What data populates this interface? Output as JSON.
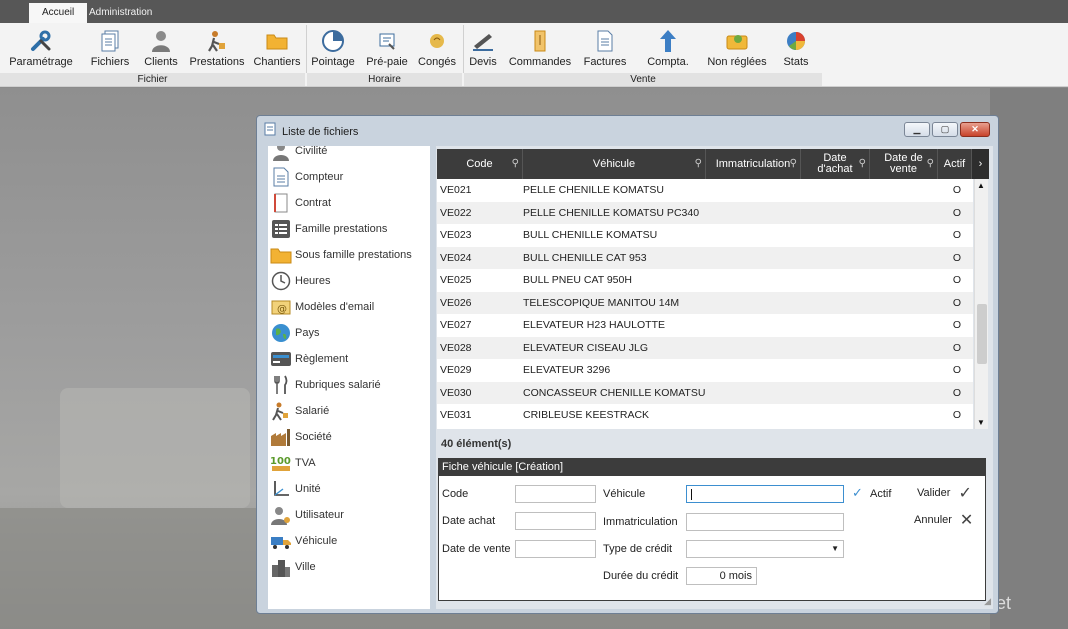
{
  "tabs": [
    {
      "label": "Accueil"
    },
    {
      "label": "Administration"
    }
  ],
  "ribbon": {
    "groups": [
      {
        "title": "Fichier",
        "items": [
          {
            "label": "Paramétrage",
            "icon": "wrench-icon"
          },
          {
            "label": "Fichiers",
            "icon": "files-icon"
          },
          {
            "label": "Clients",
            "icon": "user-icon"
          },
          {
            "label": "Prestations",
            "icon": "worker-icon"
          },
          {
            "label": "Chantiers",
            "icon": "folder-icon"
          }
        ]
      },
      {
        "title": "Horaire",
        "items": [
          {
            "label": "Pointage",
            "icon": "clock-icon"
          },
          {
            "label": "Pré-paie",
            "icon": "payroll-icon"
          },
          {
            "label": "Congés",
            "icon": "vacation-icon"
          }
        ]
      },
      {
        "title": "Vente",
        "items": [
          {
            "label": "Devis",
            "icon": "quote-icon"
          },
          {
            "label": "Commandes",
            "icon": "order-icon"
          },
          {
            "label": "Factures",
            "icon": "invoice-icon"
          },
          {
            "label": "Compta.",
            "icon": "upload-arrow-icon"
          },
          {
            "label": "Non réglées",
            "icon": "wallet-icon"
          },
          {
            "label": "Stats",
            "icon": "pie-chart-icon"
          }
        ]
      }
    ]
  },
  "window": {
    "title": "Liste de fichiers"
  },
  "sidebar": {
    "items": [
      {
        "label": "Civilité",
        "icon": "person-icon"
      },
      {
        "label": "Compteur",
        "icon": "document-icon"
      },
      {
        "label": "Contrat",
        "icon": "contract-icon"
      },
      {
        "label": "Famille prestations",
        "icon": "list-icon"
      },
      {
        "label": "Sous famille prestations",
        "icon": "folder-icon"
      },
      {
        "label": "Heures",
        "icon": "clock-icon"
      },
      {
        "label": "Modèles d'email",
        "icon": "email-icon"
      },
      {
        "label": "Pays",
        "icon": "globe-icon"
      },
      {
        "label": "Règlement",
        "icon": "payment-icon"
      },
      {
        "label": "Rubriques salarié",
        "icon": "cutlery-icon"
      },
      {
        "label": "Salarié",
        "icon": "worker-icon"
      },
      {
        "label": "Société",
        "icon": "factory-icon"
      },
      {
        "label": "TVA",
        "icon": "percent-icon"
      },
      {
        "label": "Unité",
        "icon": "axis-icon"
      },
      {
        "label": "Utilisateur",
        "icon": "user-gear-icon"
      },
      {
        "label": "Véhicule",
        "icon": "truck-icon"
      },
      {
        "label": "Ville",
        "icon": "city-icon"
      }
    ]
  },
  "grid": {
    "headers": {
      "code": "Code",
      "vehicule": "Véhicule",
      "immat": "Immatriculation",
      "date_achat": "Date\nd'achat",
      "date_vente": "Date de\nvente",
      "actif": "Actif"
    },
    "rows": [
      {
        "code": "VE021",
        "vehicule": "PELLE CHENILLE KOMATSU",
        "actif": "O"
      },
      {
        "code": "VE022",
        "vehicule": "PELLE CHENILLE KOMATSU PC340",
        "actif": "O"
      },
      {
        "code": "VE023",
        "vehicule": "BULL CHENILLE KOMATSU",
        "actif": "O"
      },
      {
        "code": "VE024",
        "vehicule": "BULL CHENILLE CAT 953",
        "actif": "O"
      },
      {
        "code": "VE025",
        "vehicule": "BULL PNEU CAT 950H",
        "actif": "O"
      },
      {
        "code": "VE026",
        "vehicule": "TELESCOPIQUE MANITOU 14M",
        "actif": "O"
      },
      {
        "code": "VE027",
        "vehicule": "ELEVATEUR H23 HAULOTTE",
        "actif": "O"
      },
      {
        "code": "VE028",
        "vehicule": "ELEVATEUR CISEAU JLG",
        "actif": "O"
      },
      {
        "code": "VE029",
        "vehicule": "ELEVATEUR 3296",
        "actif": "O"
      },
      {
        "code": "VE030",
        "vehicule": "CONCASSEUR CHENILLE KOMATSU",
        "actif": "O"
      },
      {
        "code": "VE031",
        "vehicule": "CRIBLEUSE KEESTRACK",
        "actif": "O"
      }
    ],
    "count": "40 élément(s)"
  },
  "form": {
    "title": "Fiche véhicule [Création]",
    "code_label": "Code",
    "date_achat_label": "Date achat",
    "date_vente_label": "Date de vente",
    "vehicule_label": "Véhicule",
    "immat_label": "Immatriculation",
    "type_credit_label": "Type de crédit",
    "duree_credit_label": "Durée du crédit",
    "duree_credit_value": "0 mois",
    "actif_label": "Actif",
    "valider_label": "Valider",
    "annuler_label": "Annuler"
  },
  "background": {
    "wordmark": "et"
  }
}
